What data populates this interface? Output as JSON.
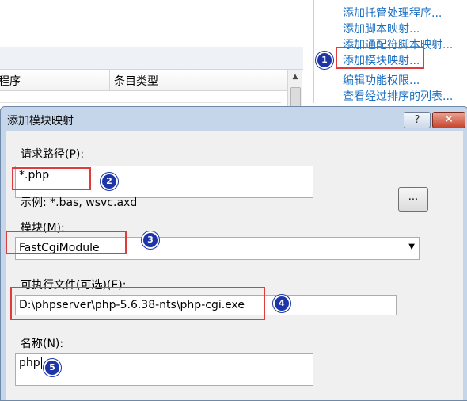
{
  "background": {
    "columns": [
      "程序",
      "条目类型"
    ],
    "actions": [
      "添加托管处理程序...",
      "添加脚本映射...",
      "添加通配符脚本映射...",
      "添加模块映射...",
      "编辑功能权限...",
      "查看经过排序的列表..."
    ]
  },
  "dialog": {
    "title": "添加模块映射",
    "help_label": "?",
    "close_label": "✕",
    "request_path": {
      "label": "请求路径(P):",
      "value": "*.php",
      "hint": "示例: *.bas, wsvc.axd"
    },
    "module": {
      "label": "模块(M):",
      "value": "FastCgiModule"
    },
    "executable": {
      "label": "可执行文件(可选)(E):",
      "value": "D:\\phpserver\\php-5.6.38-nts\\php-cgi.exe",
      "browse_label": "..."
    },
    "name": {
      "label": "名称(N):",
      "value": "php"
    }
  },
  "annotations": {
    "steps": [
      "1",
      "2",
      "3",
      "4",
      "5"
    ],
    "color": "#e23b3b",
    "badge_color": "#1d35a8"
  }
}
